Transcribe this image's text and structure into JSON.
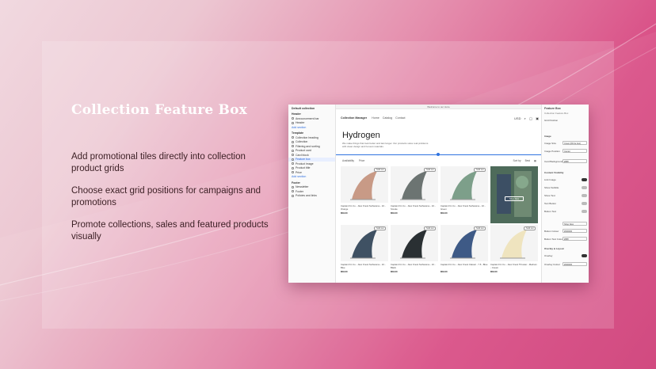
{
  "headline": "Collection Feature Box",
  "bullets": [
    "Add promotional tiles directly into collection product grids",
    "Choose exact grid positions for campaigns and promotions",
    "Promote collections, sales and featured products visually"
  ],
  "editor": {
    "left_title": "Default collection",
    "sections": [
      {
        "label": "Header",
        "type": "hdr"
      },
      {
        "label": "Announcement bar",
        "type": "item"
      },
      {
        "label": "Header",
        "type": "item"
      },
      {
        "label": "Add section",
        "type": "link"
      },
      {
        "label": "Template",
        "type": "hdr"
      },
      {
        "label": "Collection heading",
        "type": "item"
      },
      {
        "label": "Collection",
        "type": "item"
      },
      {
        "label": "Filtering and sorting",
        "type": "item"
      },
      {
        "label": "Product card",
        "type": "item"
      },
      {
        "label": "Card block",
        "type": "item"
      },
      {
        "label": "Feature box",
        "type": "sel"
      },
      {
        "label": "Product image",
        "type": "item"
      },
      {
        "label": "Product title",
        "type": "item"
      },
      {
        "label": "Price",
        "type": "item"
      },
      {
        "label": "Add section",
        "type": "link"
      },
      {
        "label": "Footer",
        "type": "hdr"
      },
      {
        "label": "Newsletter",
        "type": "item"
      },
      {
        "label": "Footer",
        "type": "item"
      },
      {
        "label": "Policies and links",
        "type": "item"
      }
    ],
    "topbar": "Welcome to our store",
    "nav": {
      "brand": "Collection Manager",
      "links": [
        "Home",
        "Catalog",
        "Contact"
      ],
      "currency": "USD"
    },
    "collection_title": "Hydrogen",
    "collection_desc": "We make things that look better and last longer. Our products solve real problems with clean design and honest materials.",
    "selection_tag": "Collection",
    "filters": {
      "availability": "Availability",
      "price": "Price",
      "sort": "Sort by",
      "best": "Best"
    },
    "products": [
      {
        "title": "Captain Fin Co. - Alex Knost Surfaceine - 10 - Orange",
        "price": "$59.00",
        "badge": "Sold out",
        "color": "#c89a86"
      },
      {
        "title": "Captain Fin Co. - Alex Knost Surfaceine - 10 - Smoke",
        "price": "$59.00",
        "badge": "Sold out",
        "color": "#6c7472"
      },
      {
        "title": "Captain Fin Co. - Alex Knost Surfaceine - 10 - Green",
        "price": "$59.00",
        "badge": "Sold out",
        "color": "#7d9f8a"
      },
      {
        "title": "Captain Fin Co. - Alex Knost Surfaceine - 10 - Blue",
        "price": "$59.00",
        "badge": "Sold out",
        "color": "#3f5163"
      },
      {
        "title": "Captain Fin Co. - Alex Knost Surfaceine - 10 - Black",
        "price": "$59.00",
        "badge": "Sold out",
        "color": "#2a3033"
      },
      {
        "title": "Captain Fin Co. - Alex Knost Classic - 7.5 - Blue",
        "price": "$59.00",
        "badge": "Sold out",
        "color": "#3e5a86"
      },
      {
        "title": "Captain Fin Co. - Alex Knost Thruster - Medium - Cream",
        "price": "$59.00",
        "badge": "Sold out",
        "color": "#efe4bf"
      }
    ],
    "feature_button": "Shop Now",
    "right": {
      "title": "Feature Box",
      "subtitle": "Collection Feature Box",
      "grid_position": "Grid Position",
      "image_hdr": "Image",
      "image_size": "Image Size",
      "image_size_val": "Cover (fill the box)",
      "image_position": "Image Position",
      "image_position_val": "Center",
      "bg_label": "Card Background Colour",
      "bg_val": "#ffffff",
      "content_hdr": "Content Visibility",
      "toggles": [
        "Link Image",
        "Show Subtitle",
        "Show Text",
        "Text Button",
        "Button Text"
      ],
      "button_val": "Shop Now",
      "button_colour": "Button Colour",
      "button_colour_val": "#000000",
      "text_colour": "Button Text Colour",
      "text_colour_val": "#ffffff",
      "spacing_hdr": "Overlay & Layout",
      "overlay": "Overlay",
      "overlay_colour": "Overlay Colour",
      "overlay_colour_val": "#000000"
    },
    "colors": {
      "accent": "#2f73e0"
    }
  }
}
